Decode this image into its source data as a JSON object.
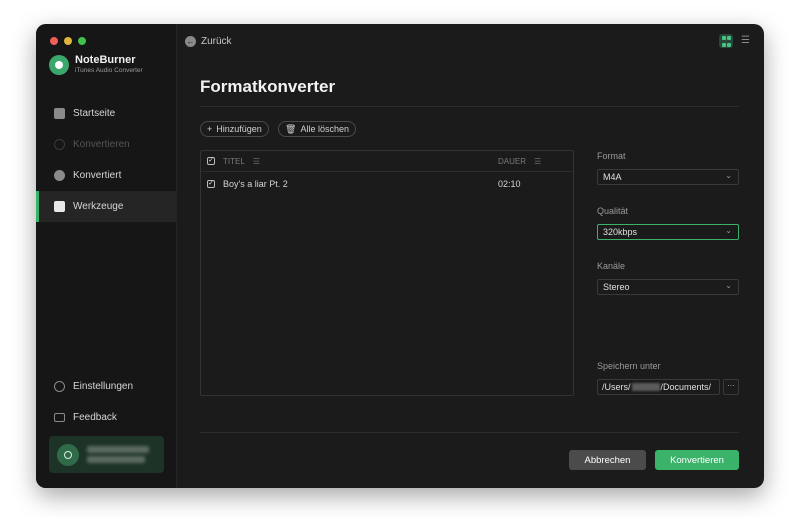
{
  "app": {
    "name": "NoteBurner",
    "subtitle": "iTunes Audio Converter"
  },
  "sidebar": {
    "items": [
      {
        "label": "Startseite",
        "icon": "home-icon"
      },
      {
        "label": "Konvertieren",
        "icon": "convert-icon"
      },
      {
        "label": "Konvertiert",
        "icon": "clock-icon"
      },
      {
        "label": "Werkzeuge",
        "icon": "toolbox-icon"
      }
    ],
    "settings_label": "Einstellungen",
    "feedback_label": "Feedback"
  },
  "header": {
    "back_label": "Zurück"
  },
  "page": {
    "title": "Formatkonverter"
  },
  "toolbar": {
    "add_label": "Hinzufügen",
    "clear_label": "Alle löschen"
  },
  "table": {
    "columns": {
      "title": "TITEL",
      "duration": "DAUER"
    },
    "rows": [
      {
        "title": "Boy's a liar Pt. 2",
        "duration": "02:10",
        "checked": true
      }
    ]
  },
  "settings": {
    "format": {
      "label": "Format",
      "value": "M4A"
    },
    "quality": {
      "label": "Qualität",
      "value": "320kbps"
    },
    "channels": {
      "label": "Kanäle",
      "value": "Stereo"
    },
    "save": {
      "label": "Speichern unter",
      "path_start": "/Users/",
      "path_end": "/Documents/",
      "browse_label": "···"
    }
  },
  "actions": {
    "cancel_label": "Abbrechen",
    "convert_label": "Konvertieren"
  },
  "colors": {
    "accent": "#3ab26a",
    "background": "#1b1b1b",
    "sidebar": "#161616"
  }
}
